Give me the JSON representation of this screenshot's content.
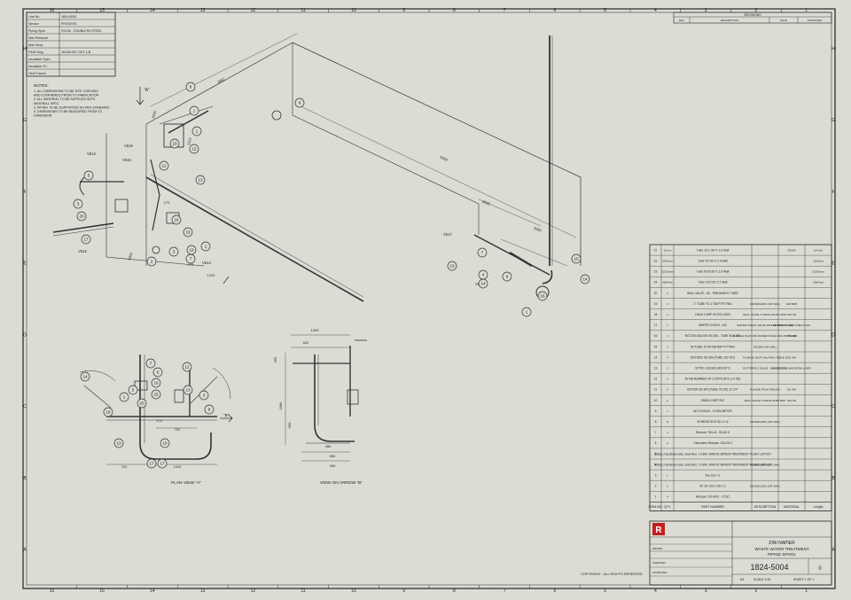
{
  "sheet": {
    "border_numbers_top": [
      "16",
      "15",
      "14",
      "13",
      "12",
      "11",
      "10",
      "9",
      "8",
      "7",
      "6",
      "5",
      "4",
      "3",
      "2",
      "1"
    ],
    "border_numbers_bottom": [
      "16",
      "15",
      "14",
      "13",
      "12",
      "11",
      "10",
      "9",
      "8",
      "7",
      "6",
      "5",
      "4",
      "3",
      "2",
      "1"
    ],
    "border_letters": [
      "H",
      "G",
      "F",
      "E",
      "D",
      "C",
      "B",
      "A"
    ]
  },
  "info_table": [
    {
      "label": "Line No",
      "value": "1824-5004"
    },
    {
      "label": "Service",
      "value": "PROCESS"
    },
    {
      "label": "Piping Spec",
      "value": "SS150 - STAINLESS STEEL"
    },
    {
      "label": "Max Pressure",
      "value": ""
    },
    {
      "label": "Max Temp",
      "value": ""
    },
    {
      "label": "P&ID Dwg",
      "value": "1813M-007-SHT-1-B"
    },
    {
      "label": "Insulation Spec",
      "value": ""
    },
    {
      "label": "Insulation Th",
      "value": ""
    },
    {
      "label": "Heat Traced",
      "value": ""
    }
  ],
  "notes": {
    "title": "NOTES:",
    "lines": [
      "1. ALL DIMENSIONS TO BE SITE CHECKED",
      "AND CONFIRMED PRIOR TO FABRICATION",
      "2. ALL MATERIAL TO BE SUPPLIED WITH",
      "MATERIAL SPEC.",
      "3. PIPING TO BE SUPPORTED AS PER STANDARD",
      "4. DIMENSIONS TO BE MEASURED FROM TO",
      "DIMENSION"
    ]
  },
  "revisions": {
    "title": "REVISIONS",
    "headers": [
      "REV",
      "DESCRIPTION",
      "DATE",
      "APPROVED"
    ]
  },
  "iso": {
    "arrow_label": "\"A\"",
    "dims": [
      "3467",
      "6000",
      "2000",
      "2000",
      "1900",
      "1207",
      "172",
      "1960",
      "172",
      "1312"
    ],
    "valves": [
      "V513",
      "V516",
      "V515",
      "V517",
      "V518",
      "V512",
      "V514"
    ],
    "balloons": [
      "8",
      "8",
      "1",
      "1",
      "12",
      "10",
      "11",
      "13",
      "5",
      "3",
      "20",
      "17",
      "16",
      "15",
      "7",
      "1",
      "3",
      "19",
      "2",
      "7",
      "13",
      "4",
      "6",
      "15",
      "14",
      "1",
      "16",
      "14"
    ]
  },
  "plan_view": {
    "caption": "PLAN VIEW \"A\"",
    "dims": [
      "702",
      "702",
      "1312",
      "172"
    ],
    "balloons": [
      "7",
      "12",
      "13",
      "15",
      "5",
      "16",
      "18",
      "20",
      "1",
      "8",
      "3",
      "13",
      "19",
      "6",
      "14",
      "17",
      "17"
    ]
  },
  "arrow_view": {
    "caption": "VIEW ON ARROW \"B\"",
    "arrow_label": "\"B\"",
    "dims": [
      "1200",
      "522",
      "1684",
      "600",
      "255",
      "550",
      "400",
      "450"
    ]
  },
  "bom": {
    "headers": [
      "ITEM NO.",
      "QTY.",
      "PART NUMBER",
      "DESCRIPTION",
      "MATERIAL",
      "Length"
    ],
    "rows": [
      {
        "item": "21",
        "qty": "37mm",
        "part": "Tube 19.1 OD X 1.6 Wall",
        "desc": "",
        "mat": "SS304",
        "len": "137mm"
      },
      {
        "item": "22",
        "qty": "1142mm",
        "part": "Tube 76 OD X 1.6 Wall",
        "desc": "",
        "mat": "",
        "len": "1142mm"
      },
      {
        "item": "23",
        "qty": "22103mm",
        "part": "Tube 50.8 OD X 1.6 Wall",
        "desc": "",
        "mat": "",
        "len": "22103mm"
      },
      {
        "item": "24",
        "qty": "2184mm",
        "part": "Tube 102 OD X 2 Wall",
        "desc": "",
        "mat": "",
        "len": "2184mm"
      },
      {
        "item": "20",
        "qty": "2",
        "part": "BALL VALVE - 50 - PNEUMATIC TUBE",
        "desc": "",
        "mat": "",
        "len": ""
      },
      {
        "item": "19",
        "qty": "2",
        "part": "1\" TUBE TO 1\" BSP PITTING",
        "desc": "AS1528-2001 (OR 304L)",
        "mat": "316 BSP",
        "len": ""
      },
      {
        "item": "18",
        "qty": "1",
        "part": "DN19.1 BSP SV22CL2003",
        "desc": "BALL VALVE 2 PIECE DN19.1 BSP",
        "mat": "316 SS",
        "len": ""
      },
      {
        "item": "17",
        "qty": "1",
        "part": "WAFER CHECK -100",
        "desc": "WATER CHECK VALVE WAFER CHECK -100",
        "mat": "EPPRAY WAFER CHECK 100",
        "len": ""
      },
      {
        "item": "16",
        "qty": "4",
        "part": "BS7105 ASA 150 SS 304 - TUBE 50.8 OD",
        "desc": "FLANGE (SLIP-ON) RAISED FACE ASA 150 SS 304",
        "mat": "SS 304",
        "len": ""
      },
      {
        "item": "15",
        "qty": "4",
        "part": "50 TUBE TO 50 NB BSP FITTING",
        "desc": "AS1528 (OR 304L)",
        "mat": "",
        "len": ""
      },
      {
        "item": "14",
        "qty": "4",
        "part": "BST2500 SS 304 (TUBE 102 OD)",
        "desc": "FLANGE (SLIP-ON) PN16 TABLE E",
        "mat": "SS 304",
        "len": ""
      },
      {
        "item": "13",
        "qty": "2",
        "part": "VF752 LUGGED-80 EST E",
        "desc": "BUTTERFLY VALVE - 80 NB EST E",
        "mat": "KEYSTONE AND EPDM LINER",
        "len": ""
      },
      {
        "item": "12",
        "qty": "2",
        "part": "50 NB NUMBER OF LOOPS 5A 5 (1.0 SS)",
        "desc": "",
        "mat": "",
        "len": ""
      },
      {
        "item": "11",
        "qty": "2",
        "part": "BST500 SS 304 (TUBE 76 OD) 12 1/4\"",
        "desc": "FLANGE PN16 TABLE E",
        "mat": "SS 304",
        "len": ""
      },
      {
        "item": "10",
        "qty": "2",
        "part": "DN50L3 BSP SV2",
        "desc": "BALL VALVE 2 PIECE DN50 BSP",
        "mat": "316 SS",
        "len": ""
      },
      {
        "item": "9",
        "qty": "1",
        "part": "AE-FLOW10 - FLOW METER",
        "desc": "",
        "mat": "",
        "len": ""
      },
      {
        "item": "8",
        "qty": "6",
        "part": "90 BEND 50.8 OD x 1.6",
        "desc": "AS1528-2001 (OR 304L)",
        "mat": "",
        "len": ""
      },
      {
        "item": "7",
        "qty": "1",
        "part": "Reducer 76/1x3 - 50.8/1.5",
        "desc": "",
        "mat": "",
        "len": ""
      },
      {
        "item": "6",
        "qty": "2",
        "part": "Concentric Reducer 102x76.2",
        "desc": "",
        "mat": "",
        "len": ""
      },
      {
        "item": "5",
        "qty": "1",
        "part": "90deg 3 to elbow tube, local Run: 2-1834, WASTE WATER TREATMENT PLANT LAYOUT",
        "desc": "",
        "mat": "",
        "len": ""
      },
      {
        "item": "4",
        "qty": "1",
        "part": "90deg 3 to elbow tube, local Run: 2-1834, WASTE WATER TREATMENT PLANT LAYOUT",
        "desc": "AS1528-2001 (OR 304L)",
        "mat": "",
        "len": ""
      },
      {
        "item": "3",
        "qty": "1",
        "part": "Tee 102 x 2",
        "desc": "",
        "mat": "",
        "len": ""
      },
      {
        "item": "2",
        "qty": "1",
        "part": "90 LR 102.0 OD x 2",
        "desc": "AS1528-2001 (OR 304L)",
        "mat": "",
        "len": ""
      },
      {
        "item": "1",
        "qty": "4",
        "part": "Reducer 102.40/2 - 72.5/1",
        "desc": "",
        "mat": "",
        "len": ""
      }
    ]
  },
  "title_block": {
    "company": "ZINI NAPIER",
    "title_lines": [
      "WASTE WATER TREATMENT",
      "PIPING SPOOL"
    ],
    "drawing_no": "1824-5004",
    "rev": "0",
    "logo_letter": "R",
    "copyright": "COPYRIGHT - ALL RIGHTS RESERVED",
    "scale": "SCALE 1:30",
    "sheet": "SHEET 1 OF 1",
    "size": "A3",
    "drawn_label": "DRAWN",
    "checked_label": "CHECKED",
    "approved_label": "APPROVED"
  },
  "colors": {
    "paper": "#dcdcd5",
    "line": "#333333",
    "thin": "#555555",
    "frame": "#1c1c1c"
  }
}
